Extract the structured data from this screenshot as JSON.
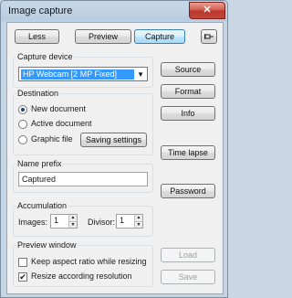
{
  "window": {
    "title": "Image capture",
    "close_glyph": "✕"
  },
  "toolbar": {
    "less": "Less",
    "preview": "Preview",
    "capture": "Capture",
    "pin_icon": "pin-icon"
  },
  "capture_device": {
    "label": "Capture device",
    "selected": "HP Webcam [2 MP Fixed]"
  },
  "right_buttons": {
    "source": "Source",
    "format": "Format",
    "info": "Info",
    "time_lapse": "Time lapse",
    "password": "Password",
    "load": "Load",
    "save": "Save"
  },
  "destination": {
    "label": "Destination",
    "options": [
      "New document",
      "Active document",
      "Graphic file"
    ],
    "selected_index": 0,
    "saving_settings": "Saving settings"
  },
  "name_prefix": {
    "label": "Name prefix",
    "value": "Captured"
  },
  "accumulation": {
    "label": "Accumulation",
    "images_label": "Images:",
    "images_value": "1",
    "divisor_label": "Divisor:",
    "divisor_value": "1"
  },
  "preview_window": {
    "label": "Preview window",
    "keep_aspect": {
      "label": "Keep aspect ratio while resizing",
      "checked": false
    },
    "resize_resolution": {
      "label": "Resize according resolution",
      "checked": true
    }
  }
}
